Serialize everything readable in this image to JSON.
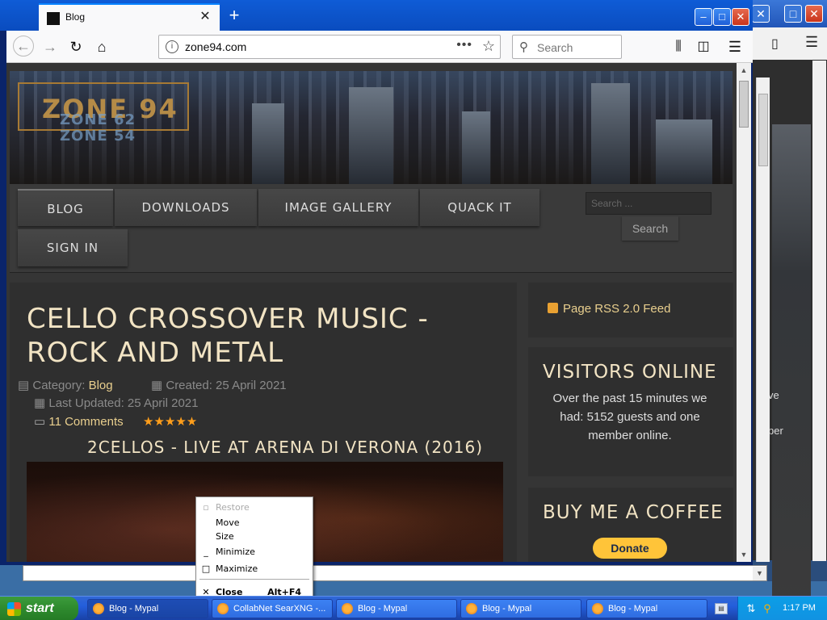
{
  "browser": {
    "tab_title": "Blog",
    "new_tab": "+",
    "url": "zone94.com",
    "url_actions": "•••",
    "search_placeholder": "Search",
    "window_buttons": {
      "minimize": "–",
      "maximize": "□",
      "close": "✕"
    }
  },
  "site": {
    "logo_main": "ZONE 94",
    "logo_sub1": "ZONE 62",
    "logo_sub2": "ZONE 54",
    "menu": [
      {
        "label": "BLOG"
      },
      {
        "label": "DOWNLOADS"
      },
      {
        "label": "IMAGE GALLERY"
      },
      {
        "label": "QUACK IT"
      },
      {
        "label": "SIGN IN"
      }
    ],
    "search_placeholder": "Search ...",
    "search_button": "Search"
  },
  "article": {
    "title": "CELLO CROSSOVER MUSIC - ROCK AND METAL",
    "category_label": "Category:",
    "category": "Blog",
    "created": "Created: 25 April 2021",
    "updated": "Last Updated: 25 April 2021",
    "comments": "11 Comments",
    "rating": "★★★★★",
    "subheading": "2CELLOS - LIVE AT ARENA DI VERONA (2016)"
  },
  "sidebar": {
    "rss": "Page RSS 2.0 Feed",
    "visitors_title": "VISITORS ONLINE",
    "visitors_text": "Over the past 15 minutes we had: 5152 guests and one member online.",
    "coffee_title": "BUY ME A COFFEE",
    "donate": "Donate"
  },
  "background_window": {
    "text1": "ve",
    "text2": "per"
  },
  "context_menu": {
    "restore": "Restore",
    "move": "Move",
    "size": "Size",
    "minimize": "Minimize",
    "maximize": "Maximize",
    "close": "Close",
    "close_shortcut": "Alt+F4"
  },
  "taskbar": {
    "start": "start",
    "items": [
      "Blog - Mypal",
      "CollabNet SearXNG -...",
      "Blog - Mypal",
      "Blog - Mypal",
      "Blog - Mypal"
    ],
    "clock": "1:17 PM"
  }
}
